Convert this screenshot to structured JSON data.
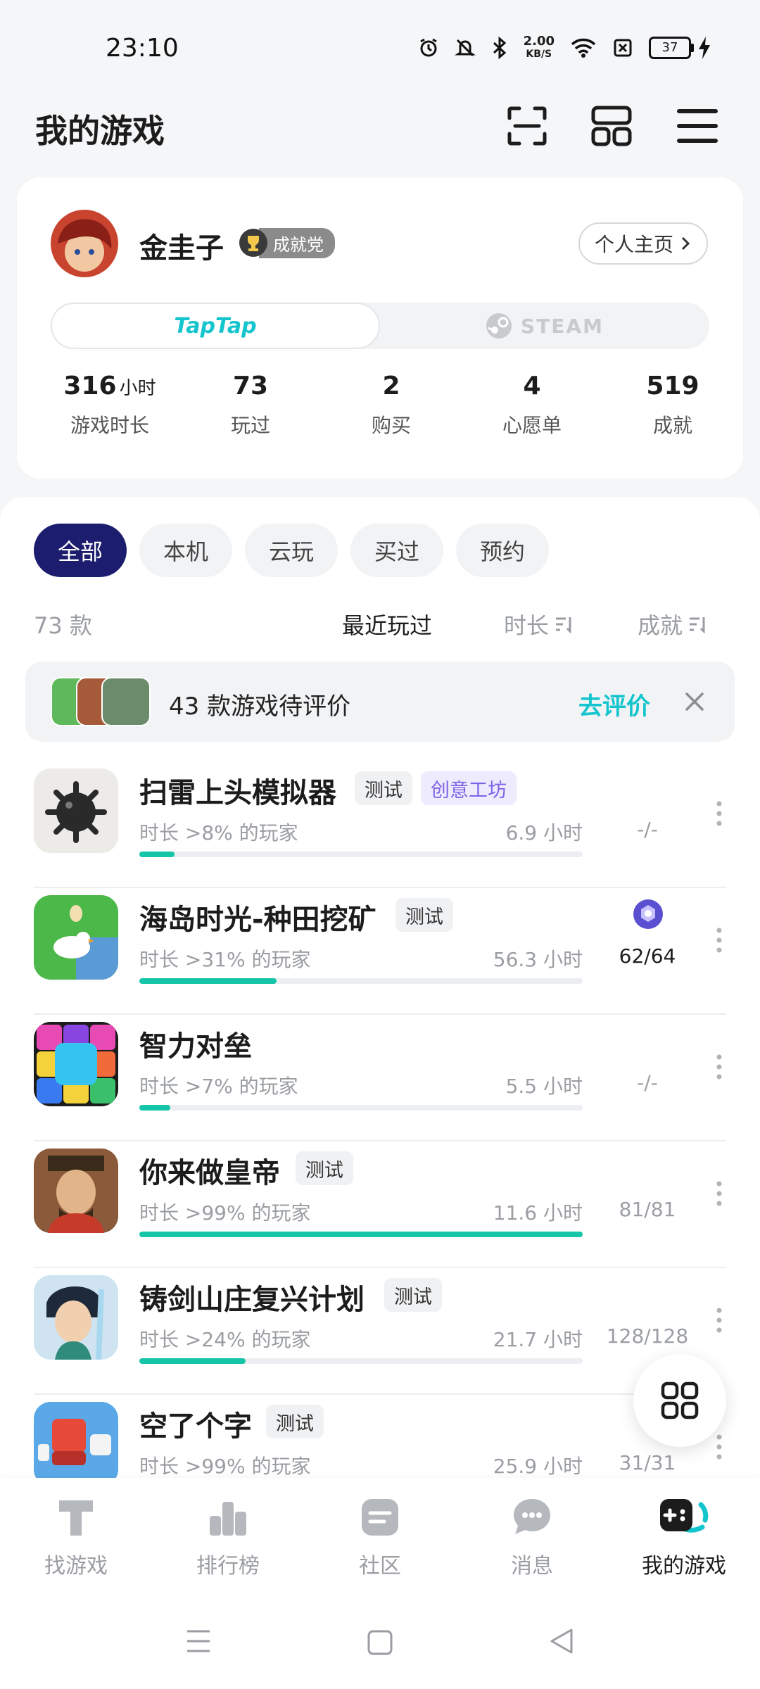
{
  "status_bar": {
    "time": "23:10",
    "speed_value": "2.00",
    "speed_unit": "KB/S",
    "battery": "37"
  },
  "header": {
    "title": "我的游戏"
  },
  "profile": {
    "username": "金圭子",
    "badge": "成就党",
    "home_button": "个人主页",
    "platforms": {
      "taptap": "TapTap",
      "steam": "STEAM"
    },
    "stats": [
      {
        "value": "316",
        "unit": "小时",
        "label": "游戏时长"
      },
      {
        "value": "73",
        "unit": "",
        "label": "玩过"
      },
      {
        "value": "2",
        "unit": "",
        "label": "购买"
      },
      {
        "value": "4",
        "unit": "",
        "label": "心愿单"
      },
      {
        "value": "519",
        "unit": "",
        "label": "成就"
      }
    ]
  },
  "filters": [
    "全部",
    "本机",
    "云玩",
    "买过",
    "预约"
  ],
  "list_header": {
    "count": "73 款",
    "sorts": [
      "最近玩过",
      "时长",
      "成就"
    ]
  },
  "review_banner": {
    "text": "43 款游戏待评价",
    "action": "去评价"
  },
  "games": [
    {
      "name": "扫雷上头模拟器",
      "tags": [
        "测试",
        "创意工坊"
      ],
      "percentile": "时长 >8% 的玩家",
      "hours": "6.9 小时",
      "progress": 0.08,
      "achievements": "-/-"
    },
    {
      "name": "海岛时光-种田挖矿",
      "tags": [
        "测试"
      ],
      "percentile": "时长 >31% 的玩家",
      "hours": "56.3 小时",
      "progress": 0.31,
      "achievements": "62/64"
    },
    {
      "name": "智力对垒",
      "tags": [],
      "percentile": "时长 >7% 的玩家",
      "hours": "5.5 小时",
      "progress": 0.07,
      "achievements": "-/-"
    },
    {
      "name": "你来做皇帝",
      "tags": [
        "测试"
      ],
      "percentile": "时长 >99% 的玩家",
      "hours": "11.6 小时",
      "progress": 1.0,
      "achievements": "81/81"
    },
    {
      "name": "铸剑山庄复兴计划",
      "tags": [
        "测试"
      ],
      "percentile": "时长 >24% 的玩家",
      "hours": "21.7 小时",
      "progress": 0.24,
      "achievements": "128/128"
    },
    {
      "name": "空了个字",
      "tags": [
        "测试"
      ],
      "percentile": "时长 >99% 的玩家",
      "hours": "25.9 小时",
      "progress": 1.0,
      "achievements": "31/31"
    }
  ],
  "bottom_nav": [
    "找游戏",
    "排行榜",
    "社区",
    "消息",
    "我的游戏"
  ],
  "colors": {
    "accent": "#15c5ce",
    "progress": "#15c5a8",
    "active_chip": "#1c1d6e",
    "purple_tag": "#7d63e8"
  }
}
